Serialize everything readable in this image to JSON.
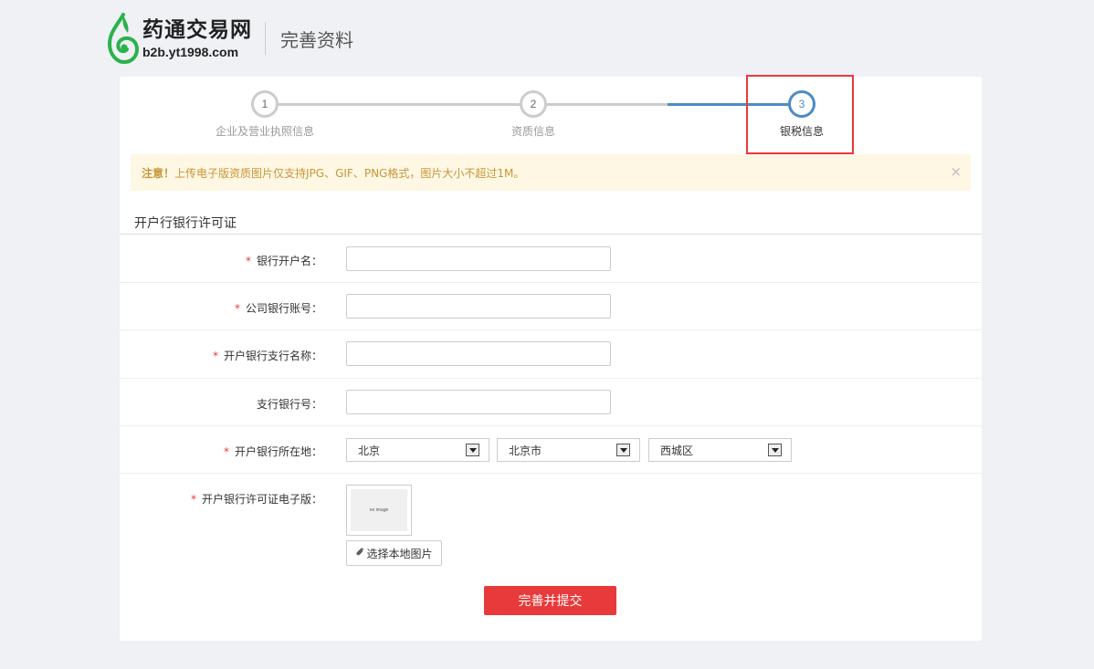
{
  "header": {
    "brand_name": "药通交易网",
    "brand_domain": "b2b.yt1998.com",
    "subtitle": "完善资料",
    "logo_icon": "leaf-swirl-icon",
    "logo_color": "#2bb24c"
  },
  "steps": [
    {
      "number": "1",
      "label": "企业及营业执照信息"
    },
    {
      "number": "2",
      "label": "资质信息"
    },
    {
      "number": "3",
      "label": "银税信息"
    }
  ],
  "notice": {
    "prefix": "注意！",
    "text": "上传电子版资质图片仅支持JPG、GIF、PNG格式，图片大小不超过1M。",
    "close": "×"
  },
  "section": {
    "title": "开户行银行许可证"
  },
  "form": {
    "required_mark": "*",
    "account_name_label": "银行开户名：",
    "account_number_label": "公司银行账号：",
    "branch_name_label": "开户银行支行名称：",
    "branch_code_label": "支行银行号：",
    "location_label": "开户银行所在地：",
    "province": "北京",
    "city": "北京市",
    "district": "西城区",
    "license_label": "开户银行许可证电子版：",
    "no_image_text": "no image",
    "upload_label": "选择本地图片",
    "submit_label": "完善并提交"
  },
  "colors": {
    "accent_blue": "#4d8cc4",
    "danger_red": "#e83a3a",
    "notice_bg": "#fdf7e3",
    "notice_text": "#c8973a"
  }
}
